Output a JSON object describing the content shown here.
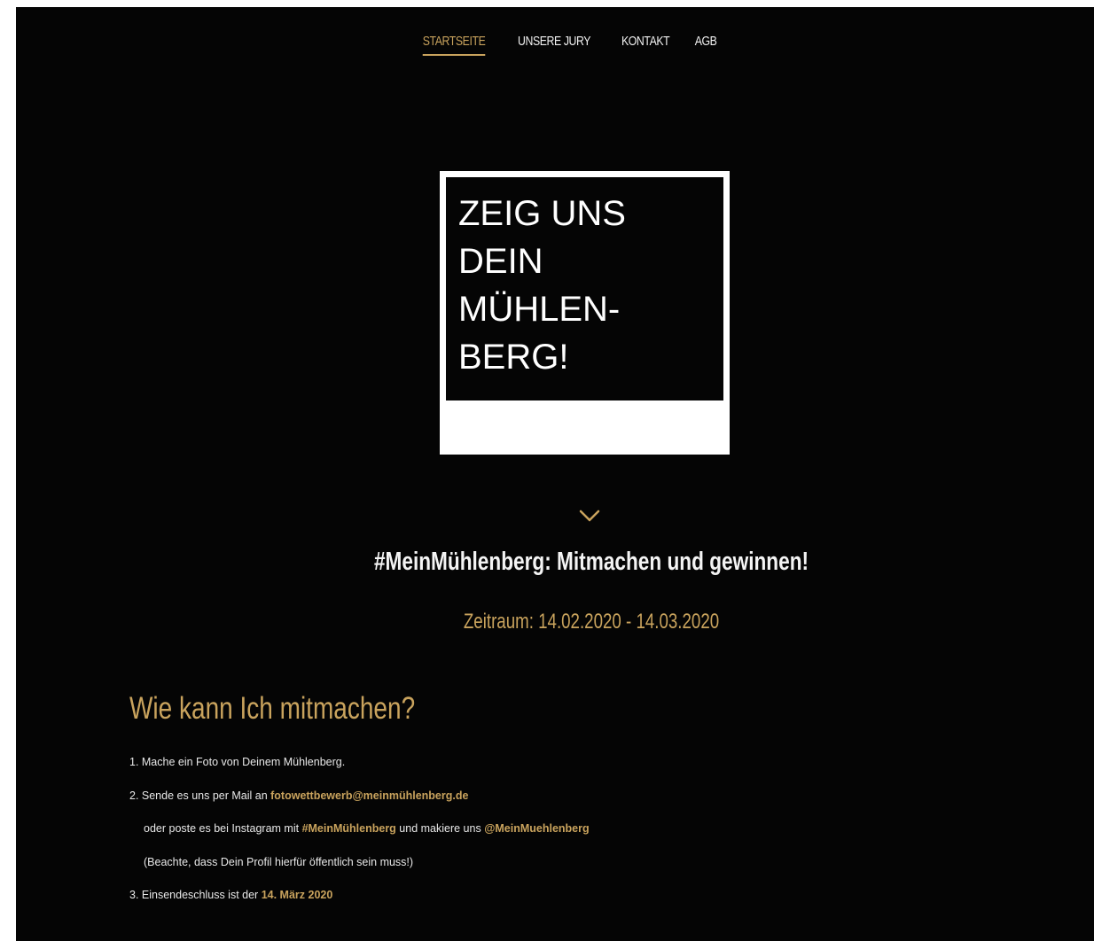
{
  "nav": {
    "items": [
      {
        "label": "STARTSEITE",
        "active": true
      },
      {
        "label": "UNSERE JURY",
        "active": false
      },
      {
        "label": "KONTAKT",
        "active": false
      },
      {
        "label": "AGB",
        "active": false
      }
    ]
  },
  "hero": {
    "lines": [
      "ZEIG UNS",
      "DEIN",
      "MÜHLEN-",
      "BERG!"
    ]
  },
  "scroll_icon": "chevron-down-icon",
  "subtitle": "#MeinMühlenberg: Mitmachen und gewinnen!",
  "period": "Zeitraum: 14.02.2020 - 14.03.2020",
  "how": {
    "title": "Wie kann Ich mitmachen?",
    "step1": "1. Mache ein Foto von Deinem Mühlenberg.",
    "step2_prefix": "2. Sende es uns per Mail an ",
    "step2_email": "fotowettbewerb@meinmühlenberg.de",
    "step2b_prefix": "oder poste es bei Instagram mit ",
    "step2b_hashtag": "#MeinMühlenberg",
    "step2b_mid": " und makiere uns ",
    "step2b_handle": "@MeinMuehlenberg",
    "step2c": "(Beachte, dass Dein Profil hierfür öffentlich sein muss!)",
    "step3_prefix": "3. Einsendeschluss ist der ",
    "step3_date": "14. März 2020"
  },
  "colors": {
    "background": "#050505",
    "accent": "#c9a35d",
    "text": "#ffffff"
  }
}
